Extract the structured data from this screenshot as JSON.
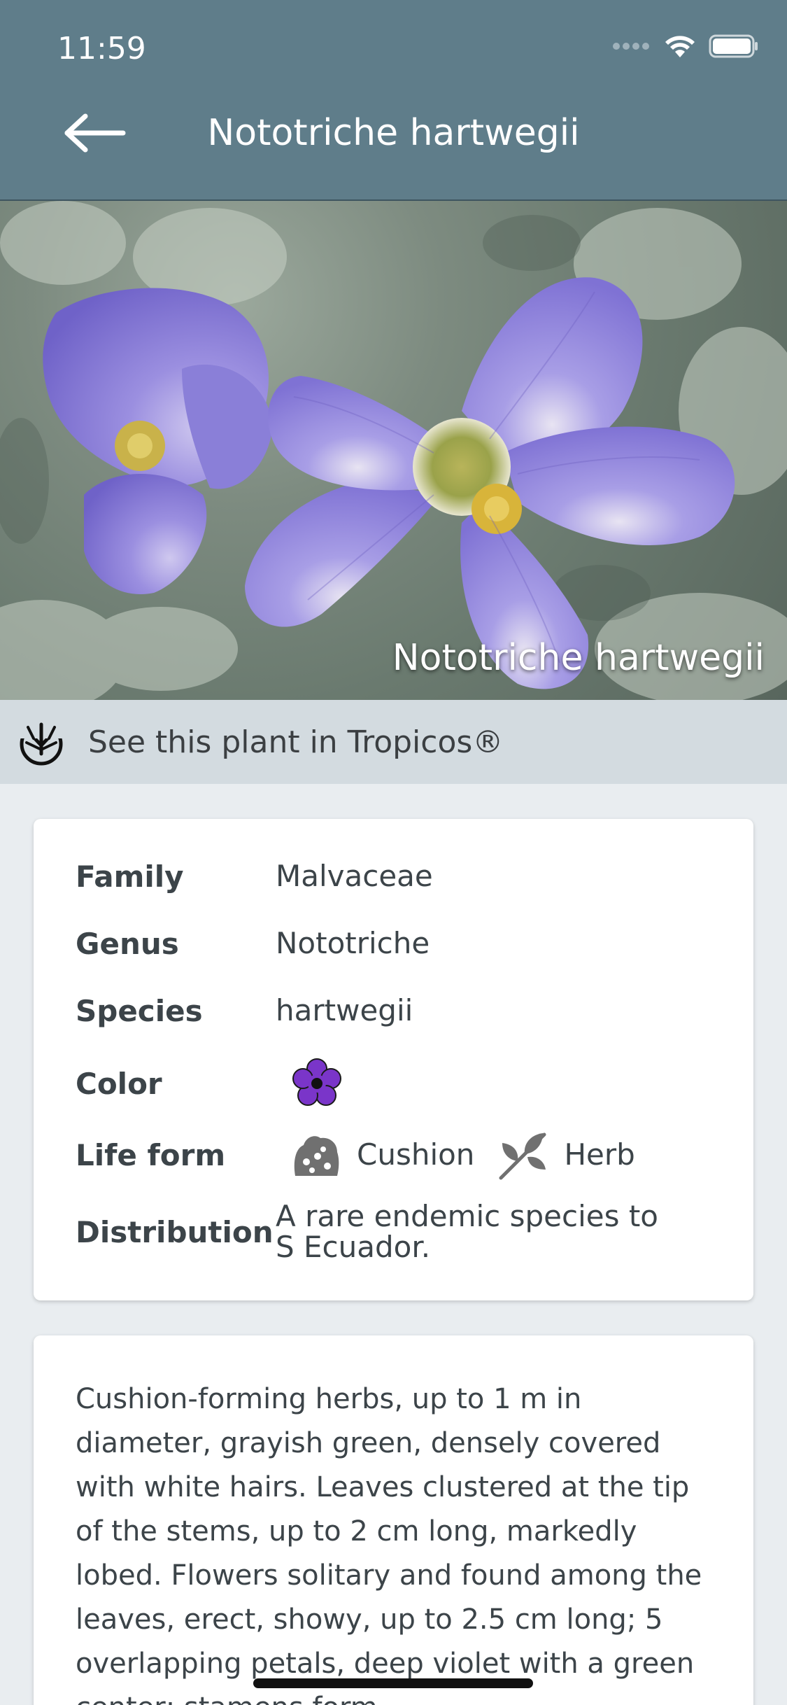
{
  "status_bar": {
    "time": "11:59"
  },
  "header": {
    "title": "Nototriche hartwegii",
    "back_icon": "arrow-left-icon"
  },
  "hero": {
    "caption": "Nototriche hartwegii"
  },
  "tropicos": {
    "label": "See this plant in Tropicos®"
  },
  "info": {
    "family_label": "Family",
    "family_value": "Malvaceae",
    "genus_label": "Genus",
    "genus_value": "Nototriche",
    "species_label": "Species",
    "species_value": "hartwegii",
    "color_label": "Color",
    "color_icon": "violet-flower-icon",
    "color_hex": "#7a35c9",
    "lifeform_label": "Life form",
    "lifeform_items": [
      "Cushion",
      "Herb"
    ],
    "distribution_label": "Distribution",
    "distribution_value": "A rare endemic species to S Ecuador."
  },
  "description": {
    "text": "Cushion-forming herbs, up to 1 m in diameter, grayish green, densely covered with white hairs. Leaves clustered at the tip of the stems, up to 2 cm long, markedly lobed. Flowers solitary and found among the leaves, erect, showy, up to 2.5 cm long; 5 overlapping petals, deep violet with a green center; stamens form"
  }
}
